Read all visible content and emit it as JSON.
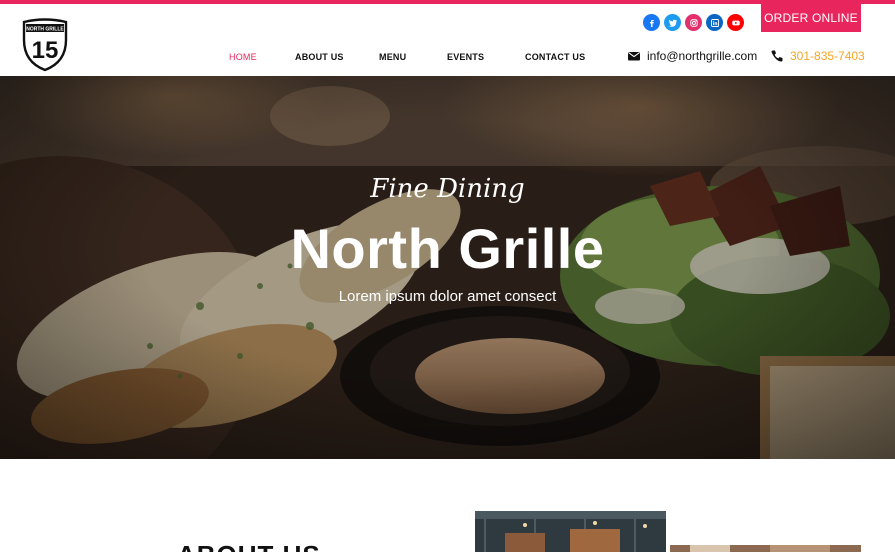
{
  "brand": {
    "logo_top_text": "NORTH GRILLE",
    "logo_number": "15"
  },
  "header": {
    "order_button": "ORDER ONLINE",
    "email": "info@northgrille.com",
    "phone": "301-835-7403"
  },
  "social": [
    {
      "icon": "facebook-icon",
      "color": "#1877f2"
    },
    {
      "icon": "twitter-icon",
      "color": "#1d9bf0"
    },
    {
      "icon": "instagram-icon",
      "color": "#e1306c"
    },
    {
      "icon": "linkedin-icon",
      "color": "#0a66c2"
    },
    {
      "icon": "youtube-icon",
      "color": "#ff0000"
    }
  ],
  "nav": {
    "items": [
      {
        "label": "HOME"
      },
      {
        "label": "ABOUT US"
      },
      {
        "label": "MENU"
      },
      {
        "label": "EVENTS"
      },
      {
        "label": "CONTACT US"
      }
    ]
  },
  "hero": {
    "subtitle": "Fine Dining",
    "title": "North Grille",
    "text": "Lorem ipsum dolor amet consect"
  },
  "about": {
    "title": "ABOUT US"
  },
  "colors": {
    "accent": "#e8265d",
    "phone": "#f5a623"
  }
}
